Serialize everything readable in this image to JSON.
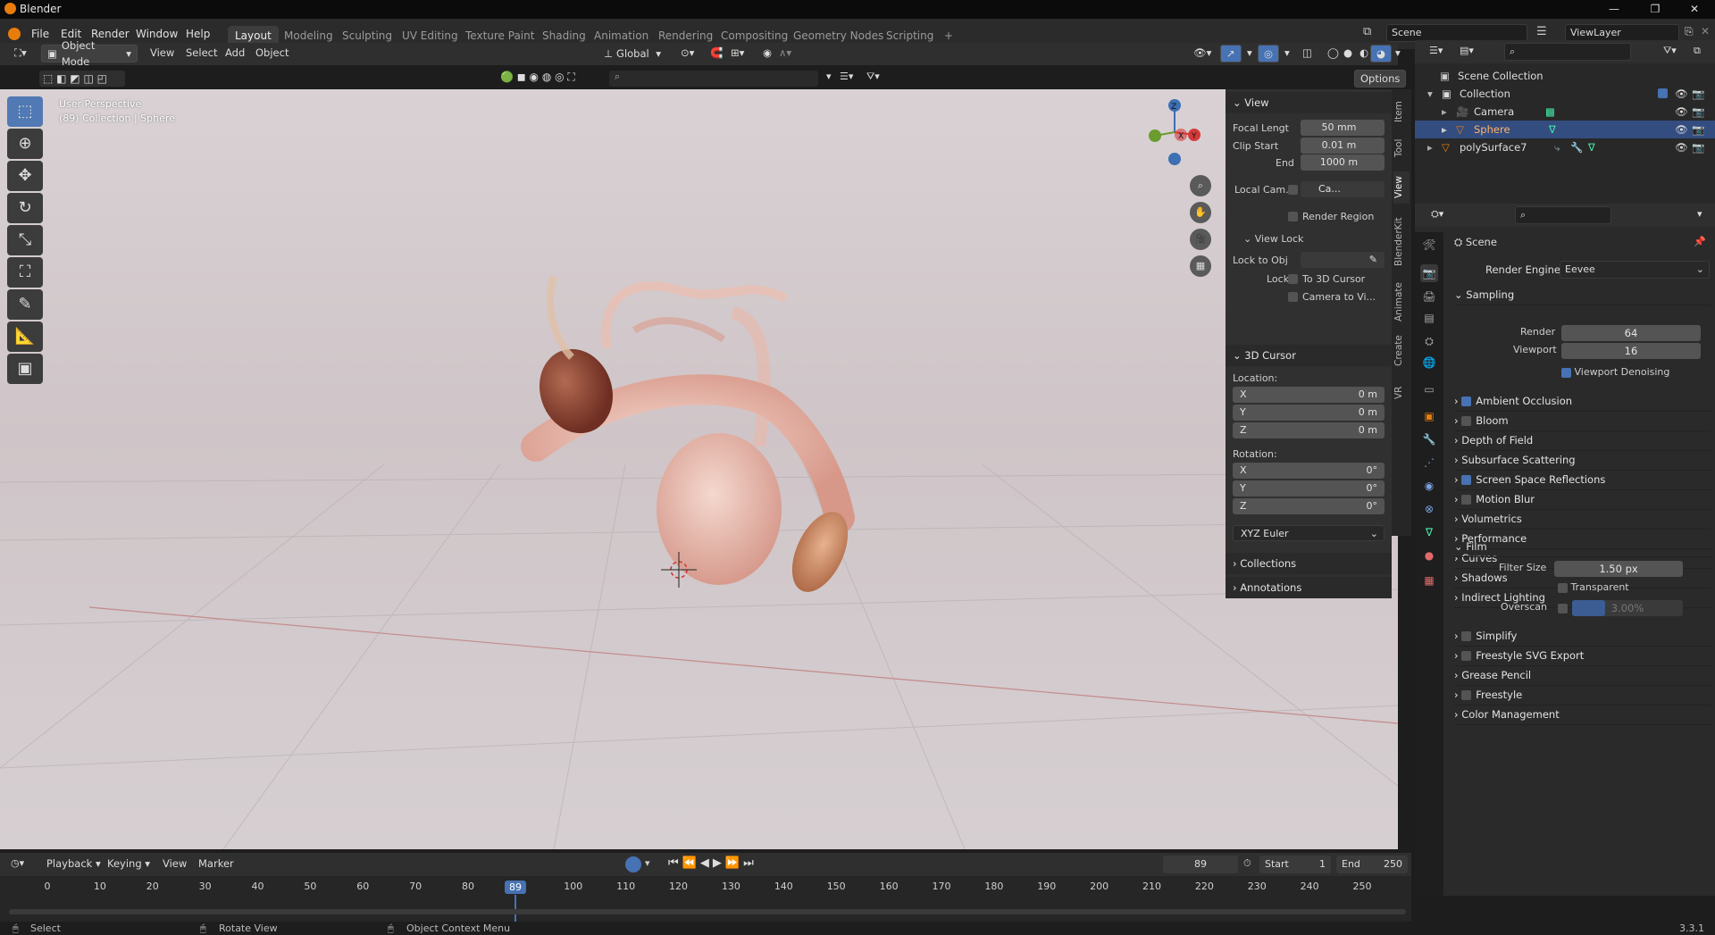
{
  "titlebar": {
    "title": "Blender",
    "min": "—",
    "restore": "❐",
    "close": "✕"
  },
  "menu": {
    "items": [
      "File",
      "Edit",
      "Render",
      "Window",
      "Help"
    ]
  },
  "workspaces": [
    "Layout",
    "Modeling",
    "Sculpting",
    "UV Editing",
    "Texture Paint",
    "Shading",
    "Animation",
    "Rendering",
    "Compositing",
    "Geometry Nodes",
    "Scripting"
  ],
  "workspace_add": "+",
  "scene": {
    "label": "Scene",
    "viewlayer": "ViewLayer"
  },
  "header": {
    "mode": "Object Mode",
    "view": "View",
    "select": "Select",
    "add": "Add",
    "object": "Object",
    "orientation": "Global",
    "options": "Options"
  },
  "viewport": {
    "perspective": "User Perspective",
    "collection_info": "(89) Collection | Sphere"
  },
  "npanel": {
    "view_title": "View",
    "focal_label": "Focal Lengt",
    "focal_value": "50 mm",
    "clip_start_label": "Clip Start",
    "clip_start_value": "0.01 m",
    "end_label": "End",
    "end_value": "1000 m",
    "local_cam_label": "Local Cam...",
    "local_cam_value": "Ca...",
    "render_region": "Render Region",
    "view_lock_title": "View Lock",
    "lock_to_obj": "Lock to Obj",
    "lock_label": "Lock",
    "to_3d_cursor": "To 3D Cursor",
    "camera_to_view": "Camera to Vi...",
    "cursor_title": "3D Cursor",
    "location_label": "Location:",
    "x": "X",
    "y": "Y",
    "z": "Z",
    "loc_x": "0 m",
    "loc_y": "0 m",
    "loc_z": "0 m",
    "rotation_label": "Rotation:",
    "rot_x": "0°",
    "rot_y": "0°",
    "rot_z": "0°",
    "rotation_mode": "XYZ Euler",
    "collections": "Collections",
    "annotations": "Annotations"
  },
  "sidetabs": [
    "Item",
    "Tool",
    "View",
    "BlenderKit",
    "Animate",
    "Create",
    "VR"
  ],
  "outliner": {
    "scene_collection": "Scene Collection",
    "collection": "Collection",
    "camera": "Camera",
    "sphere": "Sphere",
    "poly": "polySurface7"
  },
  "properties": {
    "scene": "Scene",
    "render_engine_label": "Render Engine",
    "render_engine": "Eevee",
    "sampling": "Sampling",
    "render_label": "Render",
    "render_value": "64",
    "viewport_label": "Viewport",
    "viewport_value": "16",
    "viewport_denoising": "Viewport Denoising",
    "sections": [
      {
        "label": "Ambient Occlusion",
        "check": true,
        "checked": true
      },
      {
        "label": "Bloom",
        "check": true,
        "checked": false
      },
      {
        "label": "Depth of Field",
        "check": false,
        "checked": false
      },
      {
        "label": "Subsurface Scattering",
        "check": false,
        "checked": false
      },
      {
        "label": "Screen Space Reflections",
        "check": true,
        "checked": true
      },
      {
        "label": "Motion Blur",
        "check": true,
        "checked": false
      },
      {
        "label": "Volumetrics",
        "check": false,
        "checked": false
      },
      {
        "label": "Performance",
        "check": false,
        "checked": false
      },
      {
        "label": "Curves",
        "check": false,
        "checked": false
      },
      {
        "label": "Shadows",
        "check": false,
        "checked": false
      },
      {
        "label": "Indirect Lighting",
        "check": false,
        "checked": false
      }
    ],
    "film": "Film",
    "filter_size_label": "Filter Size",
    "filter_size": "1.50 px",
    "transparent": "Transparent",
    "overscan_label": "Overscan",
    "overscan_value": "3.00%",
    "after_sections": [
      {
        "label": "Simplify",
        "check": true
      },
      {
        "label": "Freestyle SVG Export",
        "check": true
      },
      {
        "label": "Grease Pencil",
        "check": false
      },
      {
        "label": "Freestyle",
        "check": true
      },
      {
        "label": "Color Management",
        "check": false
      }
    ]
  },
  "timeline": {
    "playback": "Playback",
    "keying": "Keying",
    "view": "View",
    "marker": "Marker",
    "current_frame": "89",
    "start_label": "Start",
    "start": "1",
    "end_label": "End",
    "end": "250",
    "frames": [
      "0",
      "10",
      "20",
      "30",
      "40",
      "50",
      "60",
      "70",
      "80",
      "89",
      "100",
      "110",
      "120",
      "130",
      "140",
      "150",
      "160",
      "170",
      "180",
      "190",
      "200",
      "210",
      "220",
      "230",
      "240",
      "250"
    ]
  },
  "status": {
    "select": "Select",
    "rotate": "Rotate View",
    "context": "Object Context Menu",
    "version": "3.3.1"
  },
  "colors": {
    "accent": "#4772b3",
    "selected_row": "#334d80",
    "object_orange": "#e87d0d"
  }
}
